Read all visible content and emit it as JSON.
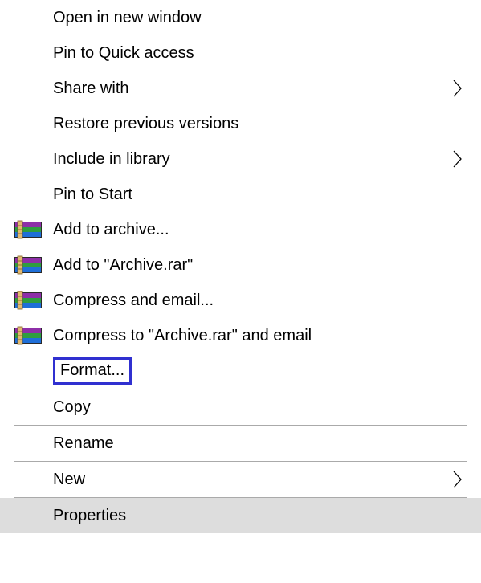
{
  "menu": {
    "items": [
      {
        "label": "Open in new window",
        "icon": null,
        "submenu": false,
        "separator_after": false
      },
      {
        "label": "Pin to Quick access",
        "icon": null,
        "submenu": false,
        "separator_after": false
      },
      {
        "label": "Share with",
        "icon": null,
        "submenu": true,
        "separator_after": false
      },
      {
        "label": "Restore previous versions",
        "icon": null,
        "submenu": false,
        "separator_after": false
      },
      {
        "label": "Include in library",
        "icon": null,
        "submenu": true,
        "separator_after": false
      },
      {
        "label": "Pin to Start",
        "icon": null,
        "submenu": false,
        "separator_after": false
      },
      {
        "label": "Add to archive...",
        "icon": "winrar",
        "submenu": false,
        "separator_after": false
      },
      {
        "label": "Add to \"Archive.rar\"",
        "icon": "winrar",
        "submenu": false,
        "separator_after": false
      },
      {
        "label": "Compress and email...",
        "icon": "winrar",
        "submenu": false,
        "separator_after": false
      },
      {
        "label": "Compress to \"Archive.rar\" and email",
        "icon": "winrar",
        "submenu": false,
        "separator_after": false
      },
      {
        "label": "Format...",
        "icon": null,
        "submenu": false,
        "highlighted": true,
        "separator_after": true
      },
      {
        "label": "Copy",
        "icon": null,
        "submenu": false,
        "separator_after": true
      },
      {
        "label": "Rename",
        "icon": null,
        "submenu": false,
        "separator_after": true
      },
      {
        "label": "New",
        "icon": null,
        "submenu": true,
        "separator_after": true
      },
      {
        "label": "Properties",
        "icon": null,
        "submenu": false,
        "hovered": true,
        "separator_after": false
      }
    ]
  }
}
